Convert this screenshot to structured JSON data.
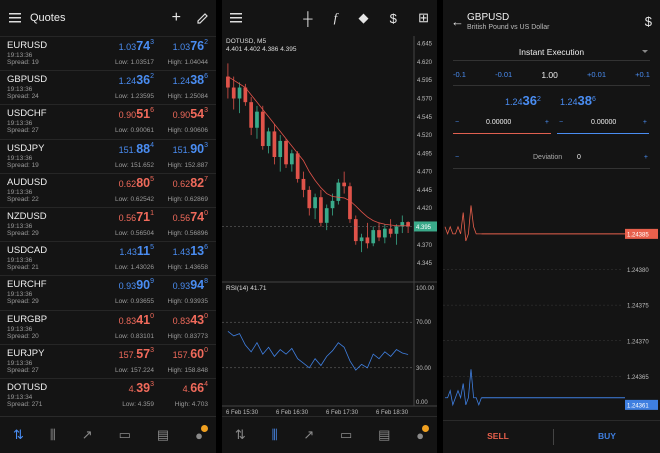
{
  "quotes_panel": {
    "title": "Quotes",
    "rows": [
      {
        "symbol": "EURUSD",
        "time": "19:13:36",
        "spread": "Spread: 19",
        "bid_main": "1.03",
        "bid_big": "74",
        "bid_sup": "3",
        "ask_main": "1.03",
        "ask_big": "76",
        "ask_sup": "2",
        "low": "Low: 1.03517",
        "high": "High: 1.04044",
        "dir": "up"
      },
      {
        "symbol": "GBPUSD",
        "time": "19:13:36",
        "spread": "Spread: 24",
        "bid_main": "1.24",
        "bid_big": "36",
        "bid_sup": "2",
        "ask_main": "1.24",
        "ask_big": "38",
        "ask_sup": "6",
        "low": "Low: 1.23595",
        "high": "High: 1.25084",
        "dir": "up"
      },
      {
        "symbol": "USDCHF",
        "time": "19:13:36",
        "spread": "Spread: 27",
        "bid_main": "0.90",
        "bid_big": "51",
        "bid_sup": "6",
        "ask_main": "0.90",
        "ask_big": "54",
        "ask_sup": "3",
        "low": "Low: 0.90061",
        "high": "High: 0.90606",
        "dir": "dn"
      },
      {
        "symbol": "USDJPY",
        "time": "19:13:36",
        "spread": "Spread: 19",
        "bid_main": "151.",
        "bid_big": "88",
        "bid_sup": "4",
        "ask_main": "151.",
        "ask_big": "90",
        "ask_sup": "3",
        "low": "Low: 151.652",
        "high": "High: 152.887",
        "dir": "up"
      },
      {
        "symbol": "AUDUSD",
        "time": "19:13:36",
        "spread": "Spread: 22",
        "bid_main": "0.62",
        "bid_big": "80",
        "bid_sup": "5",
        "ask_main": "0.62",
        "ask_big": "82",
        "ask_sup": "7",
        "low": "Low: 0.62542",
        "high": "High: 0.62869",
        "dir": "dn"
      },
      {
        "symbol": "NZDUSD",
        "time": "19:13:36",
        "spread": "Spread: 29",
        "bid_main": "0.56",
        "bid_big": "71",
        "bid_sup": "1",
        "ask_main": "0.56",
        "ask_big": "74",
        "ask_sup": "0",
        "low": "Low: 0.56504",
        "high": "High: 0.56896",
        "dir": "dn"
      },
      {
        "symbol": "USDCAD",
        "time": "19:13:36",
        "spread": "Spread: 21",
        "bid_main": "1.43",
        "bid_big": "11",
        "bid_sup": "5",
        "ask_main": "1.43",
        "ask_big": "13",
        "ask_sup": "6",
        "low": "Low: 1.43026",
        "high": "High: 1.43658",
        "dir": "up"
      },
      {
        "symbol": "EURCHF",
        "time": "19:13:36",
        "spread": "Spread: 29",
        "bid_main": "0.93",
        "bid_big": "90",
        "bid_sup": "9",
        "ask_main": "0.93",
        "ask_big": "94",
        "ask_sup": "8",
        "low": "Low: 0.93655",
        "high": "High: 0.93935",
        "dir": "up"
      },
      {
        "symbol": "EURGBP",
        "time": "19:13:36",
        "spread": "Spread: 20",
        "bid_main": "0.83",
        "bid_big": "41",
        "bid_sup": "0",
        "ask_main": "0.83",
        "ask_big": "43",
        "ask_sup": "0",
        "low": "Low: 0.83101",
        "high": "High: 0.83773",
        "dir": "dn"
      },
      {
        "symbol": "EURJPY",
        "time": "19:13:36",
        "spread": "Spread: 27",
        "bid_main": "157.",
        "bid_big": "57",
        "bid_sup": "3",
        "ask_main": "157.",
        "ask_big": "60",
        "ask_sup": "0",
        "low": "Low: 157.224",
        "high": "High: 158.848",
        "dir": "dn"
      },
      {
        "symbol": "DOTUSD",
        "time": "19:13:34",
        "spread": "Spread: 271",
        "bid_main": "4.",
        "bid_big": "39",
        "bid_sup": "3",
        "ask_main": "4.",
        "ask_big": "66",
        "ask_sup": "4",
        "low": "Low: 4.359",
        "high": "High: 4.703",
        "dir": "dn"
      }
    ]
  },
  "chart_panel": {
    "symbol_label": "DOTUSD, M5",
    "ohlc": "4.401 4.402 4.386 4.395",
    "price_axis": [
      "4.645",
      "4.620",
      "4.595",
      "4.570",
      "4.545",
      "4.520",
      "4.495",
      "4.470",
      "4.445",
      "4.420",
      "4.395",
      "4.370",
      "4.345"
    ],
    "current_price": "4.395",
    "rsi_label": "RSI(14) 41.71",
    "rsi_axis": [
      "100.00",
      "70.00",
      "30.00",
      "0.00"
    ],
    "time_axis": [
      "6 Feb 15:30",
      "6 Feb 16:30",
      "6 Feb 17:30",
      "6 Feb 18:30"
    ]
  },
  "chart_data": {
    "type": "candlestick",
    "ohlc_candles": [
      [
        4.6,
        4.618,
        4.57,
        4.585
      ],
      [
        4.585,
        4.6,
        4.555,
        4.57
      ],
      [
        4.57,
        4.592,
        4.55,
        4.585
      ],
      [
        4.585,
        4.59,
        4.56,
        4.565
      ],
      [
        4.565,
        4.572,
        4.52,
        4.53
      ],
      [
        4.53,
        4.56,
        4.515,
        4.552
      ],
      [
        4.552,
        4.56,
        4.5,
        4.505
      ],
      [
        4.505,
        4.53,
        4.495,
        4.525
      ],
      [
        4.525,
        4.535,
        4.48,
        4.49
      ],
      [
        4.49,
        4.52,
        4.47,
        4.512
      ],
      [
        4.512,
        4.515,
        4.475,
        4.48
      ],
      [
        4.48,
        4.5,
        4.47,
        4.495
      ],
      [
        4.495,
        4.498,
        4.455,
        4.46
      ],
      [
        4.46,
        4.47,
        4.435,
        4.445
      ],
      [
        4.445,
        4.45,
        4.41,
        4.42
      ],
      [
        4.42,
        4.44,
        4.405,
        4.435
      ],
      [
        4.435,
        4.445,
        4.395,
        4.4
      ],
      [
        4.4,
        4.425,
        4.39,
        4.42
      ],
      [
        4.42,
        4.44,
        4.41,
        4.43
      ],
      [
        4.43,
        4.46,
        4.425,
        4.455
      ],
      [
        4.455,
        4.47,
        4.44,
        4.45
      ],
      [
        4.45,
        4.455,
        4.4,
        4.405
      ],
      [
        4.405,
        4.41,
        4.37,
        4.375
      ],
      [
        4.375,
        4.385,
        4.36,
        4.38
      ],
      [
        4.38,
        4.4,
        4.365,
        4.372
      ],
      [
        4.372,
        4.395,
        4.368,
        4.39
      ],
      [
        4.39,
        4.4,
        4.375,
        4.38
      ],
      [
        4.38,
        4.398,
        4.372,
        4.392
      ],
      [
        4.392,
        4.405,
        4.38,
        4.385
      ],
      [
        4.385,
        4.398,
        4.37,
        4.395
      ],
      [
        4.395,
        4.41,
        4.386,
        4.401
      ],
      [
        4.401,
        4.402,
        4.386,
        4.395
      ]
    ],
    "ma_line": [
      4.6,
      4.595,
      4.59,
      4.585,
      4.575,
      4.565,
      4.555,
      4.545,
      4.535,
      4.525,
      4.515,
      4.505,
      4.495,
      4.485,
      4.47,
      4.458,
      4.448,
      4.44,
      4.436,
      4.435,
      4.434,
      4.43,
      4.423,
      4.415,
      4.408,
      4.403,
      4.4,
      4.398,
      4.397,
      4.396,
      4.396,
      4.396
    ],
    "rsi_values": [
      62,
      58,
      60,
      50,
      44,
      52,
      42,
      48,
      40,
      46,
      42,
      47,
      38,
      34,
      30,
      38,
      32,
      40,
      45,
      52,
      48,
      36,
      28,
      33,
      30,
      42,
      38,
      44,
      40,
      46,
      43,
      41.71
    ],
    "price_range": [
      4.33,
      4.65
    ],
    "rsi_range": [
      0,
      100
    ]
  },
  "order_panel": {
    "symbol": "GBPUSD",
    "description": "British Pound vs US Dollar",
    "execution": "Instant Execution",
    "volume_steps": [
      "-0.1",
      "-0.01",
      "1.00",
      "+0.01",
      "+0.1"
    ],
    "bid_main": "1.24",
    "bid_big": "36",
    "bid_sup": "2",
    "ask_main": "1.24",
    "ask_big": "38",
    "ask_sup": "6",
    "sl_value": "0.00000",
    "tp_value": "0.00000",
    "deviation_label": "Deviation",
    "deviation_value": "0",
    "price_axis": [
      "1.24385",
      "1.24380",
      "1.24375",
      "1.24370",
      "1.24365",
      "1.24361"
    ],
    "sell_label": "SELL",
    "buy_label": "BUY",
    "accent_sell": "#e8604c",
    "accent_buy": "#3f7fe0"
  },
  "order_chart_data": {
    "type": "tick",
    "bid_ticks": [
      1.24362,
      1.24362,
      1.24363,
      1.24361,
      1.24362,
      1.24363,
      1.24362,
      1.24364,
      1.24361,
      1.24362,
      1.24366,
      1.24362,
      1.24362,
      1.24361,
      1.24362
    ],
    "ask_ticks": [
      1.24386,
      1.24385,
      1.24386,
      1.24385,
      1.24385,
      1.24386,
      1.24385,
      1.24388,
      1.24384,
      1.24385,
      1.24389,
      1.24386,
      1.24385,
      1.24385,
      1.24385
    ],
    "y_range": [
      1.2436,
      1.24392
    ]
  }
}
